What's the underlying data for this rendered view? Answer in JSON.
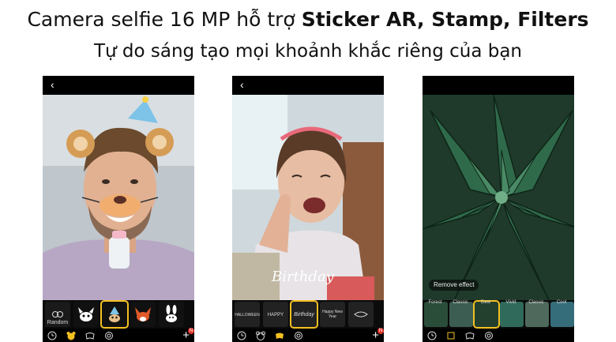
{
  "header": {
    "title_prefix": "Camera selfie 16 MP hỗ trợ ",
    "title_bold": "Sticker AR, Stamp, Filters",
    "subtitle": "Tự do sáng tạo mọi khoảnh khắc riêng của bạn"
  },
  "colors": {
    "selection": "#f3c021",
    "badge": "#e0342b",
    "bar": "#000000"
  },
  "screens": [
    {
      "name": "ar-sticker-screen",
      "back_label": "‹",
      "effects": [
        {
          "label": "Random",
          "icon": "random-icon"
        },
        {
          "label": "",
          "icon": "cat-mask-icon"
        },
        {
          "label": "",
          "icon": "party-hat-icon",
          "selected": true
        },
        {
          "label": "",
          "icon": "fox-mask-icon"
        },
        {
          "label": "",
          "icon": "bunny-mask-icon"
        }
      ],
      "bottom_icons": [
        "timer-icon",
        "sticker-icon",
        "stamp-icon",
        "filter-icon"
      ],
      "badge": "N"
    },
    {
      "name": "stamp-screen",
      "back_label": "‹",
      "stamp_text": "Birthday",
      "effects": [
        {
          "label": "HALLOWEEN",
          "icon": "stamp-icon"
        },
        {
          "label": "HAPPY",
          "icon": "stamp-icon"
        },
        {
          "label": "Birthday",
          "icon": "stamp-icon",
          "selected": true
        },
        {
          "label": "Happy New Year",
          "icon": "stamp-icon"
        },
        {
          "label": "",
          "icon": "stamp-icon"
        }
      ],
      "bottom_icons": [
        "timer-icon",
        "sticker-icon",
        "stamp-icon",
        "filter-icon"
      ],
      "badge": "N"
    },
    {
      "name": "filter-screen",
      "back_label": "",
      "remove_effect": "Remove effect",
      "filter_names": [
        "Forest",
        "Classic",
        "Dew",
        "Vivid",
        "Classic",
        "Cool"
      ],
      "bottom_icons": [
        "timer-icon",
        "sticker-icon",
        "stamp-icon",
        "filter-icon"
      ]
    }
  ]
}
